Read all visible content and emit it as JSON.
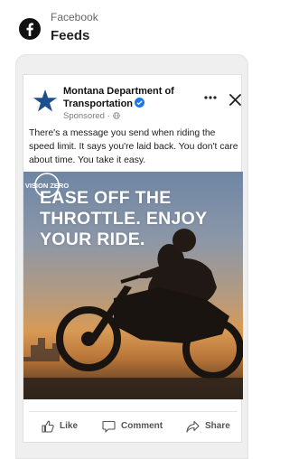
{
  "header": {
    "app_name": "Facebook",
    "section_title": "Feeds",
    "logo_icon": "facebook-logo-icon"
  },
  "post": {
    "page_name": "Montana Department of Transportation",
    "verified": true,
    "sponsored_label": "Sponsored ·",
    "body_text": "There's a message you send when riding the speed limit. It says you're laid back. You don't care about time. You take it easy.",
    "image": {
      "headline": "EASE OFF THE THROTTLE. ENJOY YOUR RIDE.",
      "brand_mark": "VISION ZERO",
      "description": "silhouette of a motorcyclist at sunset"
    },
    "actions": [
      {
        "label": "Like",
        "icon": "thumbs-up-icon"
      },
      {
        "label": "Comment",
        "icon": "comment-icon"
      },
      {
        "label": "Share",
        "icon": "share-arrow-icon"
      }
    ]
  },
  "colors": {
    "brand_blue": "#1877f2",
    "page_star": "#1d4f8c",
    "text": "#1c1c1c",
    "muted": "#7a7a7a"
  }
}
